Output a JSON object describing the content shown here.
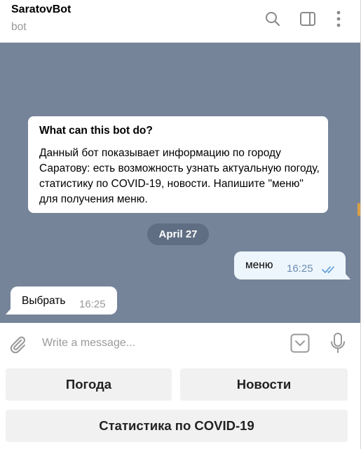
{
  "header": {
    "title": "SaratovBot",
    "subtitle": "bot",
    "icons": [
      "search-icon",
      "sidebar-toggle-icon",
      "more-icon"
    ]
  },
  "chat": {
    "intro": {
      "title": "What can this bot do?",
      "text": "Данный бот показывает информацию по городу Саратову: есть возможность узнать актуальную погоду, статистику по COVID-19, новости. Напишите \"меню\" для получения меню."
    },
    "date_label": "April 27",
    "messages": [
      {
        "direction": "outgoing",
        "text": "меню",
        "time": "16:25",
        "status": "read"
      },
      {
        "direction": "incoming",
        "text": "Выбрать",
        "time": "16:25"
      }
    ]
  },
  "composer": {
    "placeholder": "Write a message...",
    "icons": [
      "paperclip-icon",
      "keyboard-toggle-icon",
      "microphone-icon"
    ]
  },
  "bot_keyboard": {
    "rows": [
      [
        "Погода",
        "Новости"
      ],
      [
        "Статистика по COVID-19"
      ]
    ]
  },
  "colors": {
    "chat_background": "#76849a",
    "outgoing_bubble": "#eef6fd",
    "incoming_bubble": "#ffffff",
    "date_pill": "#5f6e82",
    "read_checks": "#5b9bd5",
    "keyboard_button": "#f1f1f1"
  }
}
